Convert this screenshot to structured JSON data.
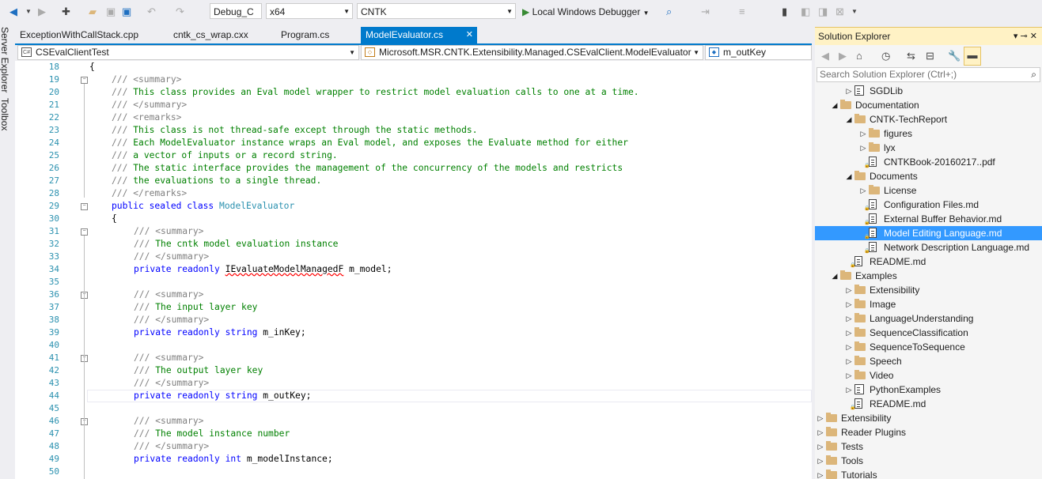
{
  "toolbar": {
    "config": "Debug_C",
    "platform": "x64",
    "project": "CNTK",
    "run_label": "Local Windows Debugger"
  },
  "left_strip": {
    "server_explorer": "Server Explorer",
    "toolbox": "Toolbox"
  },
  "tabs": [
    {
      "label": "ExceptionWithCallStack.cpp"
    },
    {
      "label": "cntk_cs_wrap.cxx"
    },
    {
      "label": "Program.cs"
    },
    {
      "label": "ModelEvaluator.cs"
    }
  ],
  "tab_close": "✕",
  "navbar": {
    "project": "CSEvalClientTest",
    "class": "Microsoft.MSR.CNTK.Extensibility.Managed.CSEvalClient.ModelEvaluator",
    "member": "m_outKey"
  },
  "editor": {
    "lines": [
      {
        "n": "18",
        "t": "{"
      },
      {
        "n": "19",
        "t": "/// <summary>"
      },
      {
        "n": "20",
        "t": "/// This class provides an Eval model wrapper to restrict model evaluation calls to one at a time."
      },
      {
        "n": "21",
        "t": "/// </summary>"
      },
      {
        "n": "22",
        "t": "/// <remarks>"
      },
      {
        "n": "23",
        "t": "/// This class is not thread-safe except through the static methods."
      },
      {
        "n": "24",
        "t": "/// Each ModelEvaluator instance wraps an Eval model, and exposes the Evaluate method for either"
      },
      {
        "n": "25",
        "t": "/// a vector of inputs or a record string."
      },
      {
        "n": "26",
        "t": "/// The static interface provides the management of the concurrency of the models and restricts"
      },
      {
        "n": "27",
        "t": "/// the evaluations to a single thread."
      },
      {
        "n": "28",
        "t": "/// </remarks>"
      },
      {
        "n": "29",
        "t": "public sealed class ModelEvaluator"
      },
      {
        "n": "30",
        "t": "{"
      },
      {
        "n": "31",
        "t": "/// <summary>"
      },
      {
        "n": "32",
        "t": "/// The cntk model evaluation instance"
      },
      {
        "n": "33",
        "t": "/// </summary>"
      },
      {
        "n": "34",
        "t": "private readonly IEvaluateModelManagedF m_model;"
      },
      {
        "n": "35",
        "t": ""
      },
      {
        "n": "36",
        "t": "/// <summary>"
      },
      {
        "n": "37",
        "t": "/// The input layer key"
      },
      {
        "n": "38",
        "t": "/// </summary>"
      },
      {
        "n": "39",
        "t": "private readonly string m_inKey;"
      },
      {
        "n": "40",
        "t": ""
      },
      {
        "n": "41",
        "t": "/// <summary>"
      },
      {
        "n": "42",
        "t": "/// The output layer key"
      },
      {
        "n": "43",
        "t": "/// </summary>"
      },
      {
        "n": "44",
        "t": "private readonly string m_outKey;"
      },
      {
        "n": "45",
        "t": ""
      },
      {
        "n": "46",
        "t": "/// <summary>"
      },
      {
        "n": "47",
        "t": "/// The model instance number"
      },
      {
        "n": "48",
        "t": "/// </summary>"
      },
      {
        "n": "49",
        "t": "private readonly int m_modelInstance;"
      },
      {
        "n": "50",
        "t": ""
      }
    ]
  },
  "solution_explorer": {
    "title": "Solution Explorer",
    "pin": "▾ ⊸ ✕",
    "search_placeholder": "Search Solution Explorer (Ctrl+;)",
    "items": [
      {
        "label": "SGDLib",
        "kind": "project",
        "expand": "right"
      },
      {
        "label": "Documentation",
        "kind": "folder",
        "expand": "down"
      },
      {
        "label": "CNTK-TechReport",
        "kind": "folder",
        "expand": "down"
      },
      {
        "label": "figures",
        "kind": "folder",
        "expand": "right"
      },
      {
        "label": "lyx",
        "kind": "folder",
        "expand": "right"
      },
      {
        "label": "CNTKBook-20160217..pdf",
        "kind": "file",
        "expand": ""
      },
      {
        "label": "Documents",
        "kind": "folder",
        "expand": "down"
      },
      {
        "label": "License",
        "kind": "folder",
        "expand": "right"
      },
      {
        "label": "Configuration Files.md",
        "kind": "file",
        "expand": ""
      },
      {
        "label": "External Buffer Behavior.md",
        "kind": "file",
        "expand": ""
      },
      {
        "label": "Model Editing Language.md",
        "kind": "file",
        "expand": "",
        "selected": true
      },
      {
        "label": "Network Description Language.md",
        "kind": "file",
        "expand": ""
      },
      {
        "label": "README.md",
        "kind": "file",
        "expand": ""
      },
      {
        "label": "Examples",
        "kind": "folder",
        "expand": "down"
      },
      {
        "label": "Extensibility",
        "kind": "folder",
        "expand": "right"
      },
      {
        "label": "Image",
        "kind": "folder",
        "expand": "right"
      },
      {
        "label": "LanguageUnderstanding",
        "kind": "folder",
        "expand": "right"
      },
      {
        "label": "SequenceClassification",
        "kind": "folder",
        "expand": "right"
      },
      {
        "label": "SequenceToSequence",
        "kind": "folder",
        "expand": "right"
      },
      {
        "label": "Speech",
        "kind": "folder",
        "expand": "right"
      },
      {
        "label": "Video",
        "kind": "folder",
        "expand": "right"
      },
      {
        "label": "PythonExamples",
        "kind": "pyproject",
        "expand": "right"
      },
      {
        "label": "README.md",
        "kind": "file",
        "expand": ""
      },
      {
        "label": "Extensibility",
        "kind": "folder",
        "expand": "right"
      },
      {
        "label": "Reader Plugins",
        "kind": "folder",
        "expand": "right"
      },
      {
        "label": "Tests",
        "kind": "folder",
        "expand": "right"
      },
      {
        "label": "Tools",
        "kind": "folder",
        "expand": "right"
      },
      {
        "label": "Tutorials",
        "kind": "folder",
        "expand": "right"
      }
    ]
  }
}
